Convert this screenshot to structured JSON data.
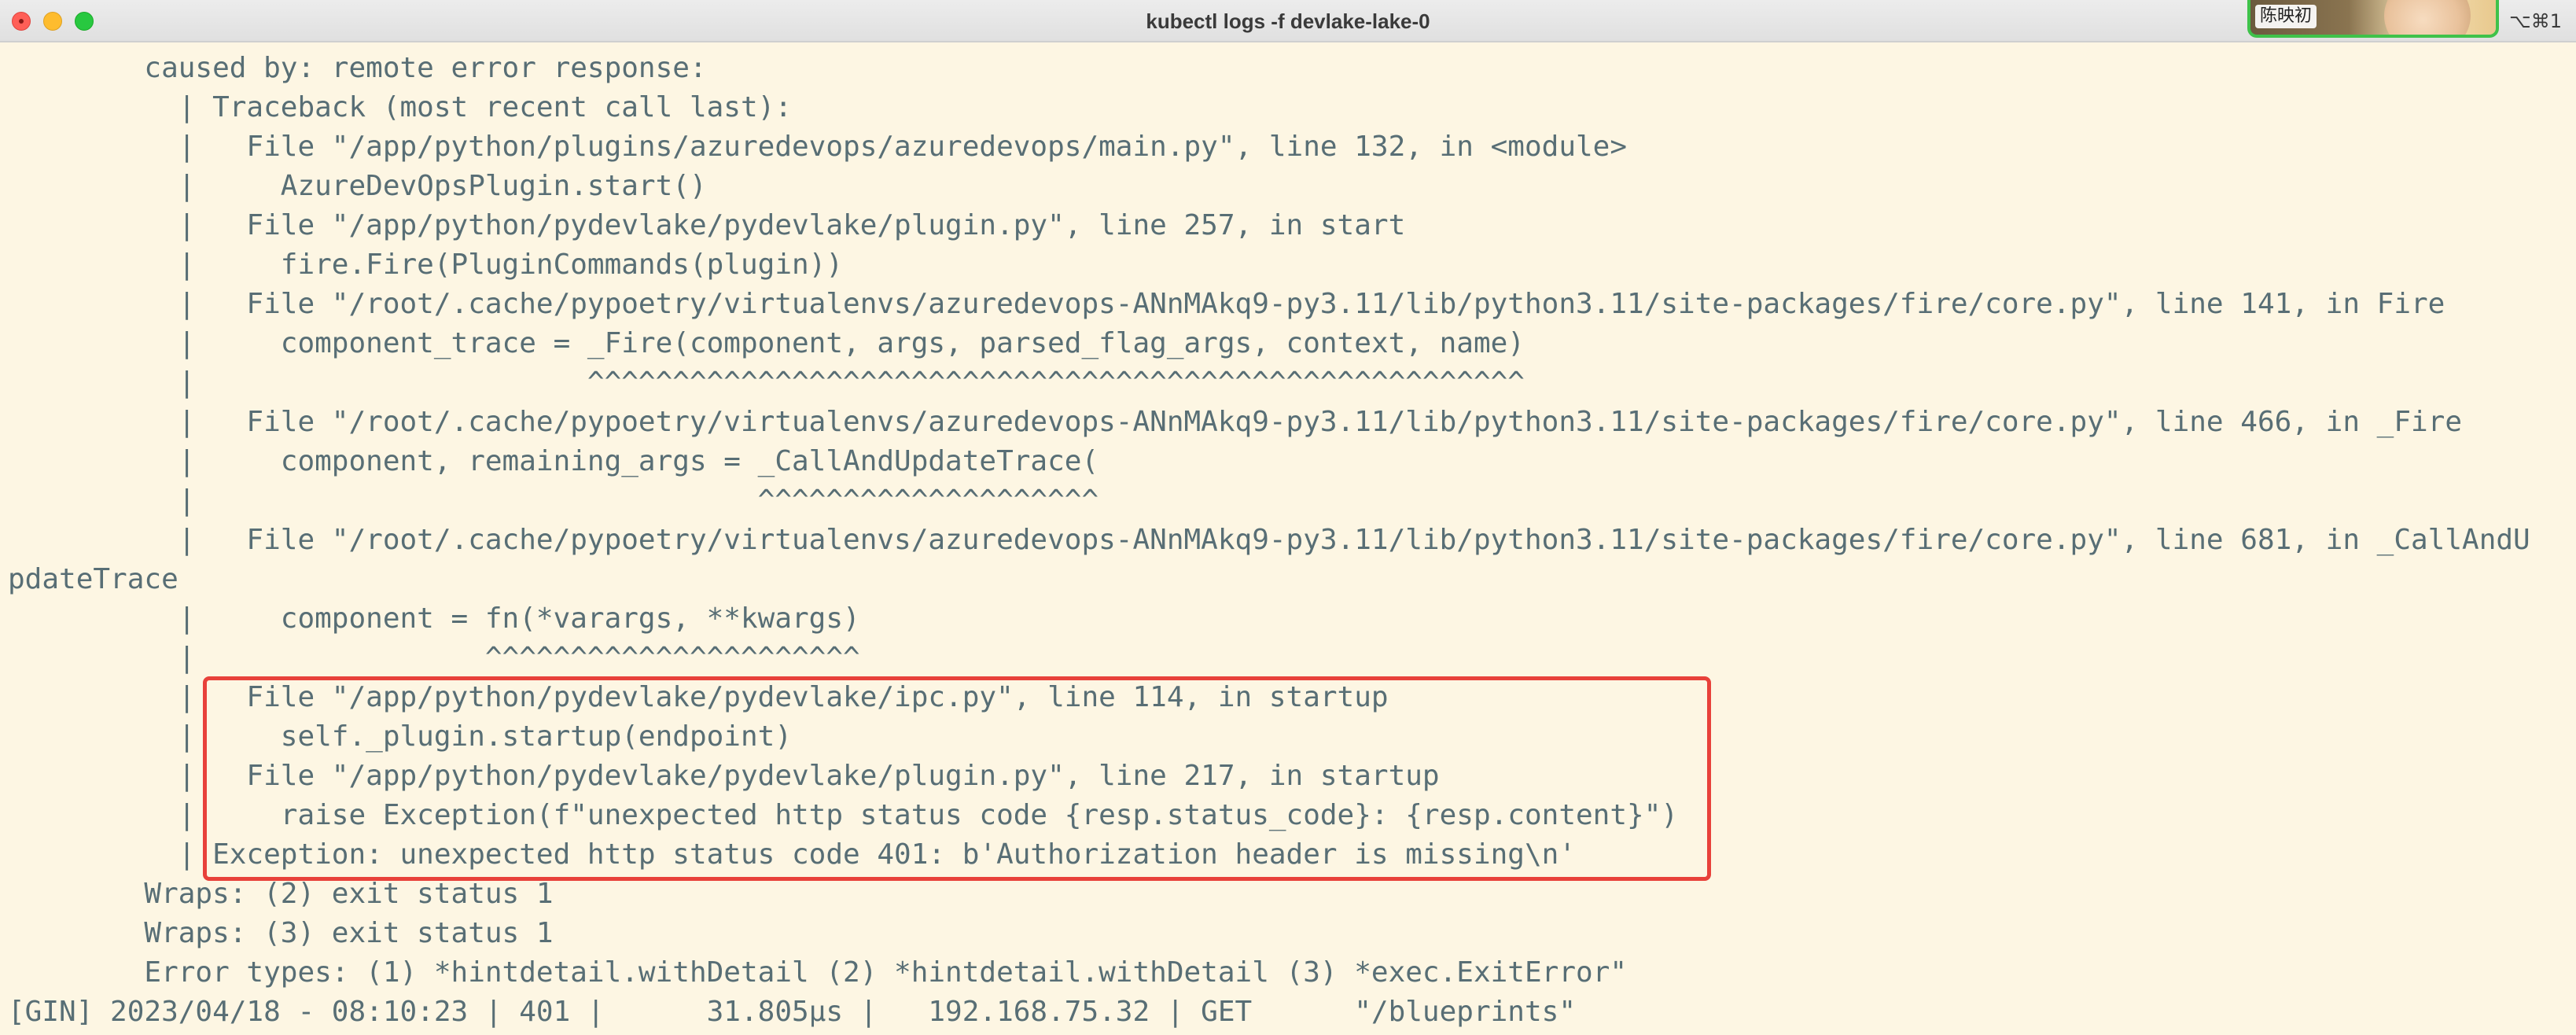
{
  "window": {
    "title": "kubectl logs -f devlake-lake-0",
    "shortcut": "⌥⌘1"
  },
  "video_tile": {
    "name": "陈映初"
  },
  "colors": {
    "background": "#fdf6e3",
    "text": "#586e75",
    "highlight_border": "#e8413a"
  },
  "terminal": {
    "lines": [
      "        caused by: remote error response:",
      "          | Traceback (most recent call last):",
      "          |   File \"/app/python/plugins/azuredevops/azuredevops/main.py\", line 132, in <module>",
      "          |     AzureDevOpsPlugin.start()",
      "          |   File \"/app/python/pydevlake/pydevlake/plugin.py\", line 257, in start",
      "          |     fire.Fire(PluginCommands(plugin))",
      "          |   File \"/root/.cache/pypoetry/virtualenvs/azuredevops-ANnMAkq9-py3.11/lib/python3.11/site-packages/fire/core.py\", line 141, in Fire",
      "          |     component_trace = _Fire(component, args, parsed_flag_args, context, name)",
      "          |                       ^^^^^^^^^^^^^^^^^^^^^^^^^^^^^^^^^^^^^^^^^^^^^^^^^^^^^^^",
      "          |   File \"/root/.cache/pypoetry/virtualenvs/azuredevops-ANnMAkq9-py3.11/lib/python3.11/site-packages/fire/core.py\", line 466, in _Fire",
      "          |     component, remaining_args = _CallAndUpdateTrace(",
      "          |                                 ^^^^^^^^^^^^^^^^^^^^",
      "          |   File \"/root/.cache/pypoetry/virtualenvs/azuredevops-ANnMAkq9-py3.11/lib/python3.11/site-packages/fire/core.py\", line 681, in _CallAndU",
      "pdateTrace",
      "          |     component = fn(*varargs, **kwargs)",
      "          |                 ^^^^^^^^^^^^^^^^^^^^^^",
      "          |   File \"/app/python/pydevlake/pydevlake/ipc.py\", line 114, in startup",
      "          |     self._plugin.startup(endpoint)",
      "          |   File \"/app/python/pydevlake/pydevlake/plugin.py\", line 217, in startup",
      "          |     raise Exception(f\"unexpected http status code {resp.status_code}: {resp.content}\")",
      "          | Exception: unexpected http status code 401: b'Authorization header is missing\\n'",
      "        Wraps: (2) exit status 1",
      "        Wraps: (3) exit status 1",
      "        Error types: (1) *hintdetail.withDetail (2) *hintdetail.withDetail (3) *exec.ExitError\"",
      "[GIN] 2023/04/18 - 08:10:23 | 401 |      31.805µs |   192.168.75.32 | GET      \"/blueprints\""
    ]
  }
}
